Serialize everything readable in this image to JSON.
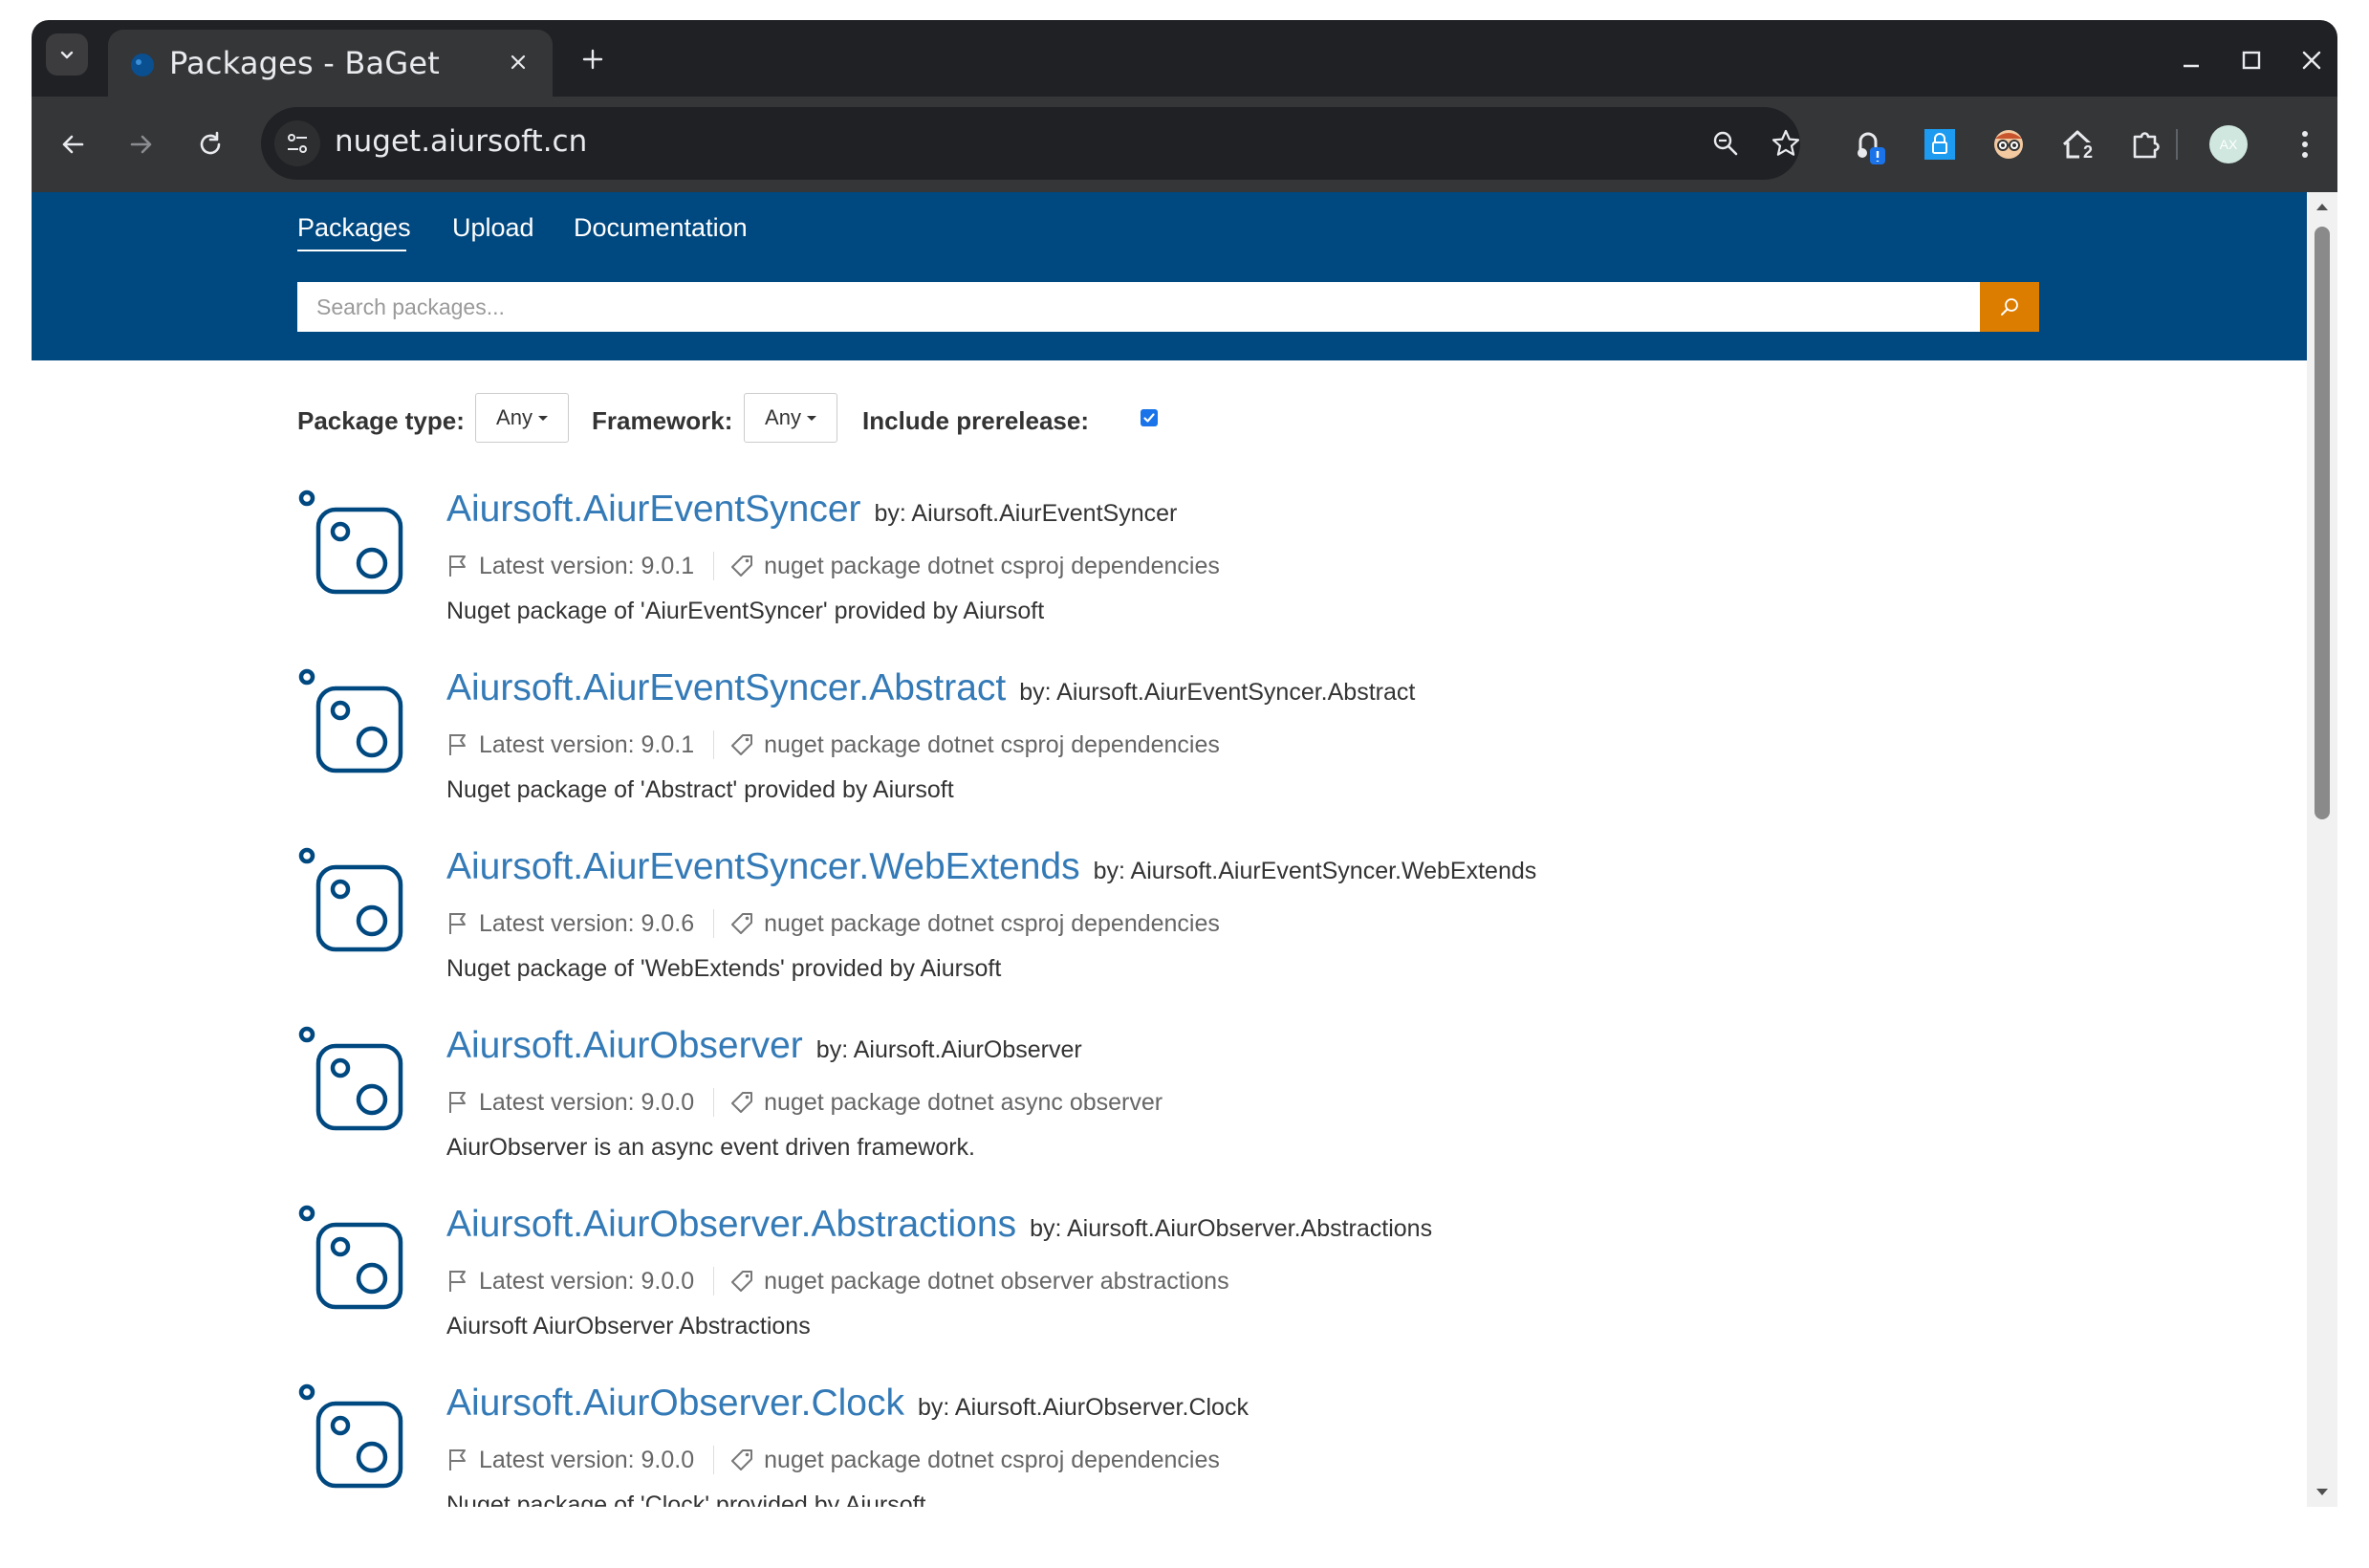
{
  "browser": {
    "tab_title": "Packages - BaGet",
    "url": "nuget.aiursoft.cn",
    "extension_badge": "2",
    "avatar_initials": "AX"
  },
  "nav": {
    "links": [
      "Packages",
      "Upload",
      "Documentation"
    ],
    "active": "Packages"
  },
  "search": {
    "placeholder": "Search packages..."
  },
  "filters": {
    "package_type_label": "Package type:",
    "package_type_value": "Any",
    "framework_label": "Framework:",
    "framework_value": "Any",
    "prerelease_label": "Include prerelease:",
    "prerelease_checked": true
  },
  "packages": [
    {
      "title": "Aiursoft.AiurEventSyncer",
      "author": "by: Aiursoft.AiurEventSyncer",
      "version": "Latest version: 9.0.1",
      "tags": "nuget package dotnet csproj dependencies",
      "description": "Nuget package of 'AiurEventSyncer' provided by Aiursoft"
    },
    {
      "title": "Aiursoft.AiurEventSyncer.Abstract",
      "author": "by: Aiursoft.AiurEventSyncer.Abstract",
      "version": "Latest version: 9.0.1",
      "tags": "nuget package dotnet csproj dependencies",
      "description": "Nuget package of 'Abstract' provided by Aiursoft"
    },
    {
      "title": "Aiursoft.AiurEventSyncer.WebExtends",
      "author": "by: Aiursoft.AiurEventSyncer.WebExtends",
      "version": "Latest version: 9.0.6",
      "tags": "nuget package dotnet csproj dependencies",
      "description": "Nuget package of 'WebExtends' provided by Aiursoft"
    },
    {
      "title": "Aiursoft.AiurObserver",
      "author": "by: Aiursoft.AiurObserver",
      "version": "Latest version: 9.0.0",
      "tags": "nuget package dotnet async observer",
      "description": "AiurObserver is an async event driven framework."
    },
    {
      "title": "Aiursoft.AiurObserver.Abstractions",
      "author": "by: Aiursoft.AiurObserver.Abstractions",
      "version": "Latest version: 9.0.0",
      "tags": "nuget package dotnet observer abstractions",
      "description": "Aiursoft AiurObserver Abstractions"
    },
    {
      "title": "Aiursoft.AiurObserver.Clock",
      "author": "by: Aiursoft.AiurObserver.Clock",
      "version": "Latest version: 9.0.0",
      "tags": "nuget package dotnet csproj dependencies",
      "description": "Nuget package of 'Clock' provided by Aiursoft"
    }
  ],
  "colors": {
    "nav_background": "#004880",
    "search_button": "#dd7d00",
    "link": "#337ab7",
    "package_icon": "#004880"
  }
}
